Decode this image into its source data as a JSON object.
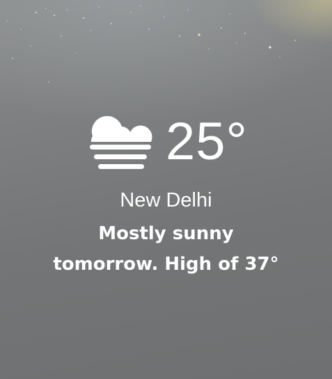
{
  "weather": {
    "icon": "fog-icon",
    "temperature": "25°",
    "location": "New Delhi",
    "forecast_line1": "Mostly sunny",
    "forecast_line2": "tomorrow. High of 37°"
  },
  "colors": {
    "text": "#ffffff",
    "background": "#7a7c7d",
    "glow": "#d6ce96"
  }
}
